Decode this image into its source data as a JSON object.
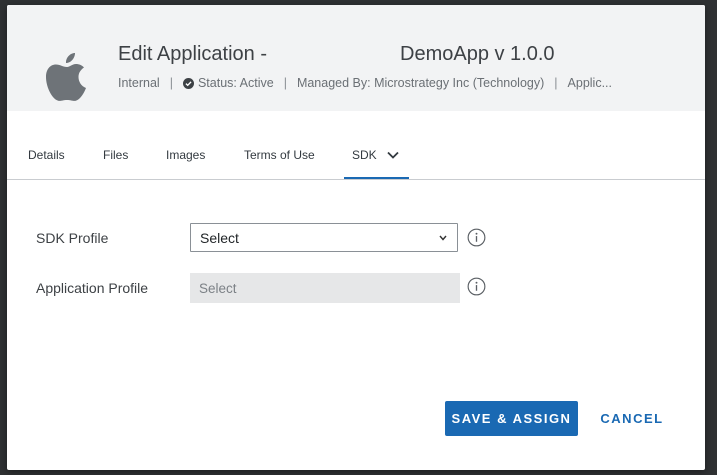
{
  "header": {
    "title": "Edit Application -",
    "app_name": "DemoApp v 1.0.0",
    "icon": "apple-icon",
    "meta": {
      "visibility": "Internal",
      "status": "Status: Active",
      "managed_by": "Managed By: Microstrategy Inc (Technology)",
      "extra": "Applic..."
    }
  },
  "tabs": [
    {
      "label": "Details"
    },
    {
      "label": "Files"
    },
    {
      "label": "Images"
    },
    {
      "label": "Terms of Use"
    },
    {
      "label": "SDK",
      "active": true
    }
  ],
  "form": {
    "sdk_profile": {
      "label": "SDK Profile",
      "value": "Select"
    },
    "application_profile": {
      "label": "Application Profile",
      "placeholder": "Select"
    }
  },
  "actions": {
    "save_assign": "SAVE & ASSIGN",
    "cancel": "CANCEL"
  },
  "colors": {
    "accent": "#1a69b3",
    "header_bg": "#f2f3f4",
    "disabled_bg": "#e6e7e8"
  }
}
